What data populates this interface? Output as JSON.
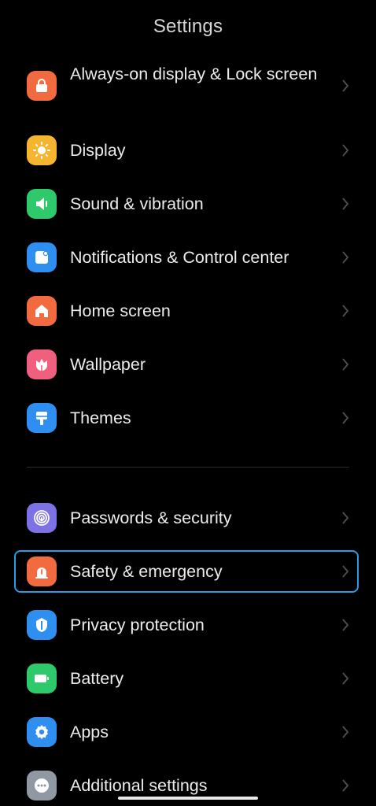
{
  "header": {
    "title": "Settings"
  },
  "items": [
    {
      "label": "Always-on display & Lock screen",
      "icon": "lock-icon",
      "color": "#f26a3f"
    },
    {
      "label": "Display",
      "icon": "sun-icon",
      "color": "#f5b52e"
    },
    {
      "label": "Sound & vibration",
      "icon": "speaker-icon",
      "color": "#2ec96a"
    },
    {
      "label": "Notifications & Control center",
      "icon": "notification-icon",
      "color": "#2f8ff0"
    },
    {
      "label": "Home screen",
      "icon": "home-icon",
      "color": "#f26a3f"
    },
    {
      "label": "Wallpaper",
      "icon": "flower-icon",
      "color": "#f0607e"
    },
    {
      "label": "Themes",
      "icon": "brush-icon",
      "color": "#2f8ff0"
    },
    {
      "label": "Passwords & security",
      "icon": "fingerprint-icon",
      "color": "#7c72e6"
    },
    {
      "label": "Safety & emergency",
      "icon": "alarm-icon",
      "color": "#f26a3f"
    },
    {
      "label": "Privacy protection",
      "icon": "shield-icon",
      "color": "#2f8ff0"
    },
    {
      "label": "Battery",
      "icon": "battery-icon",
      "color": "#2ec96a"
    },
    {
      "label": "Apps",
      "icon": "gear-icon",
      "color": "#2f8ff0"
    },
    {
      "label": "Additional settings",
      "icon": "more-icon",
      "color": "#8f98a3"
    }
  ],
  "selected_item": "Safety & emergency",
  "accent_color": "#2a9be6"
}
